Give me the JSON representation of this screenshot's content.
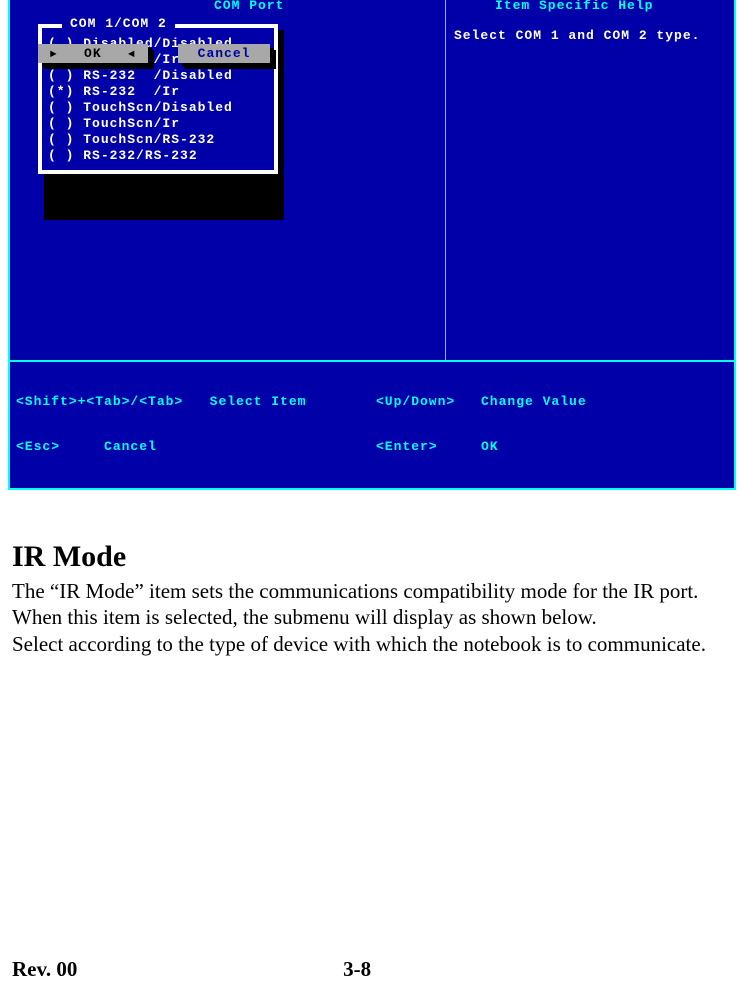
{
  "bios": {
    "left_panel_title": "COM Port",
    "right_panel_title": "Item Specific Help",
    "help_text": "Select COM 1 and COM 2 type.",
    "popup_title": "COM 1/COM 2",
    "options": [
      {
        "selected": false,
        "label": "Disabled/Disabled"
      },
      {
        "selected": false,
        "label": "Disabled/Ir"
      },
      {
        "selected": false,
        "label": "RS-232  /Disabled"
      },
      {
        "selected": true,
        "label": "RS-232  /Ir"
      },
      {
        "selected": false,
        "label": "TouchScn/Disabled"
      },
      {
        "selected": false,
        "label": "TouchScn/Ir"
      },
      {
        "selected": false,
        "label": "TouchScn/RS-232"
      },
      {
        "selected": false,
        "label": "RS-232/RS-232"
      }
    ],
    "buttons": {
      "ok": "OK",
      "cancel": "Cancel"
    },
    "footer": {
      "line1_keys": "<Shift>+<Tab>/<Tab>",
      "line1_action": "Select Item",
      "line1_right_key": "<Up/Down>",
      "line1_right_action": "Change Value",
      "line2_keys": "<Esc>",
      "line2_action": "Cancel",
      "line2_right_key": "<Enter>",
      "line2_right_action": "OK"
    }
  },
  "doc": {
    "heading": "IR Mode",
    "para1": "The “IR Mode” item sets the communications compatibility mode for the IR port.",
    "para2": "When this item is selected, the submenu will display as shown below.",
    "para3": "Select according to the type of device with which the notebook is to communicate.",
    "footer_left": "Rev. 00",
    "footer_page": "3-8"
  }
}
